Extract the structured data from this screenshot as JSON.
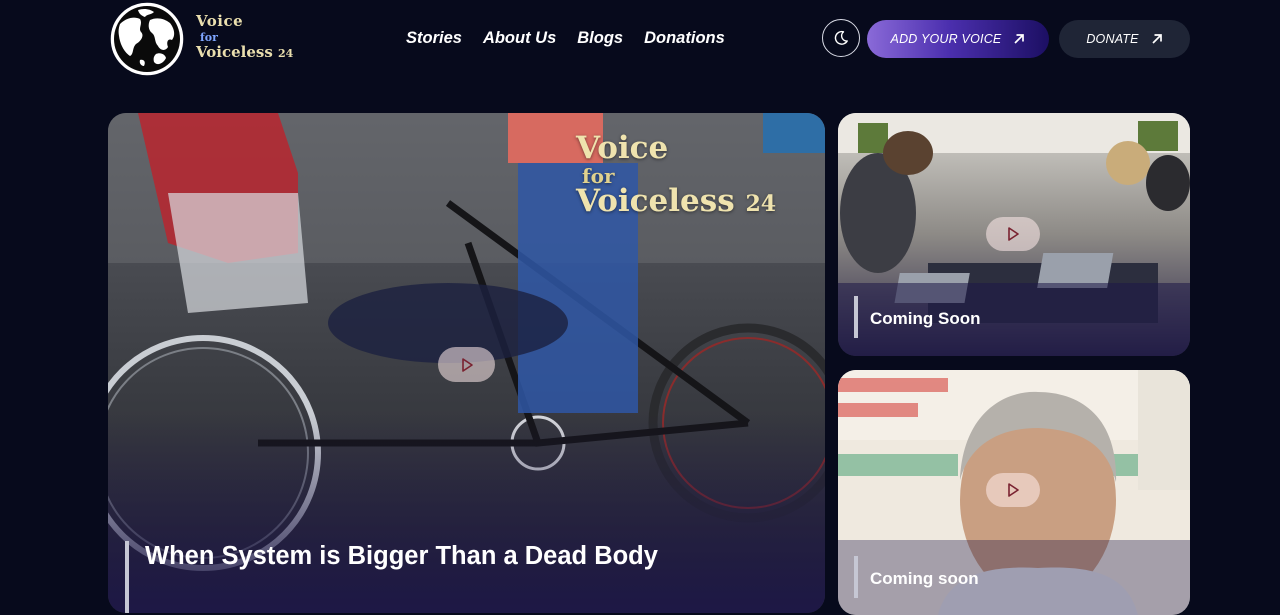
{
  "brand": {
    "line1": "Voice",
    "line2": "for",
    "line3": "Voiceless",
    "suffix": "24",
    "gold": "#eadfae"
  },
  "nav": {
    "items": [
      {
        "label": "Stories"
      },
      {
        "label": "About Us"
      },
      {
        "label": "Blogs"
      },
      {
        "label": "Donations"
      }
    ]
  },
  "header_actions": {
    "theme_icon": "moon-icon",
    "add_voice_label": "ADD YOUR VOICE",
    "donate_label": "DONATE",
    "arrow_icon": "arrow-up-right-icon",
    "accent": "#4b2fae"
  },
  "featured": {
    "title": "When System is Bigger Than a Dead Body",
    "watermark": {
      "line1": "Voice",
      "line2": "for",
      "line3": "Voiceless",
      "suffix": "24"
    },
    "play_icon": "play-icon"
  },
  "side_cards": [
    {
      "caption": "Coming Soon",
      "play_icon": "play-icon"
    },
    {
      "caption": "Coming soon",
      "play_icon": "play-icon"
    }
  ],
  "colors": {
    "background": "#070a1c",
    "card_overlay": "#1d1747"
  }
}
